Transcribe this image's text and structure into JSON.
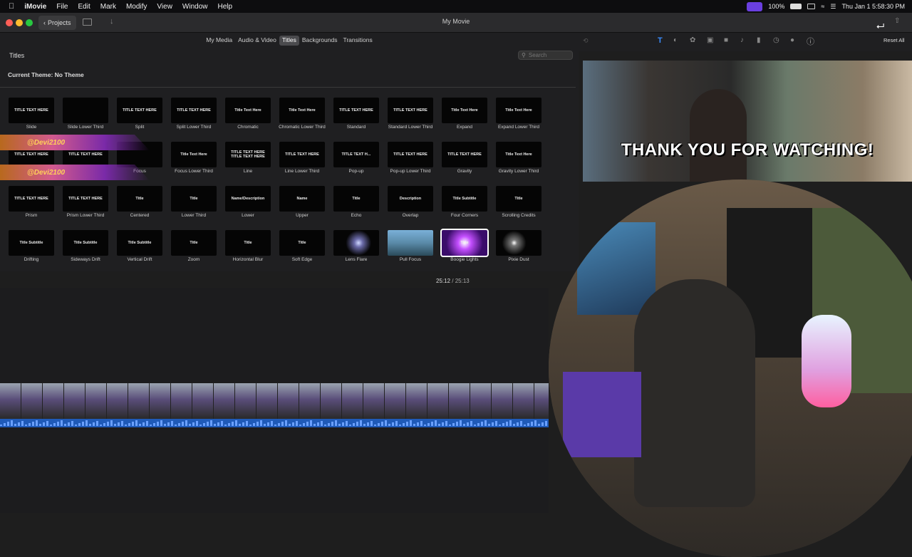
{
  "menubar": {
    "apple": "",
    "app": "iMovie",
    "items": [
      "File",
      "Edit",
      "Mark",
      "Modify",
      "View",
      "Window",
      "Help"
    ],
    "battery": "100%",
    "clock": "Thu Jan 1  5:58:30 PM"
  },
  "toolbar": {
    "projects_label": "Projects",
    "window_title": "My Movie",
    "reset_all": "Reset All"
  },
  "browser": {
    "tabs": [
      "My Media",
      "Audio & Video",
      "Titles",
      "Backgrounds",
      "Transitions"
    ],
    "active_tab": "Titles",
    "heading": "Titles",
    "search_placeholder": "Search",
    "theme": "Current Theme: No Theme",
    "titles": [
      {
        "label": "Slide",
        "thumb": "TITLE TEXT HERE"
      },
      {
        "label": "Slide Lower Third",
        "thumb": ""
      },
      {
        "label": "Split",
        "thumb": "TITLE TEXT HERE"
      },
      {
        "label": "Split Lower Third",
        "thumb": "TITLE TEXT HERE"
      },
      {
        "label": "Chromatic",
        "thumb": "Title Text Here"
      },
      {
        "label": "Chromatic Lower Third",
        "thumb": "Title Text Here"
      },
      {
        "label": "Standard",
        "thumb": "TITLE TEXT HERE"
      },
      {
        "label": "Standard Lower Third",
        "thumb": "TITLE TEXT HERE"
      },
      {
        "label": "Expand",
        "thumb": "Title Text Here"
      },
      {
        "label": "Expand Lower Third",
        "thumb": "Title Text Here"
      },
      {
        "label": "Focus",
        "thumb": "TITLE TEXT HERE"
      },
      {
        "label": "Focus",
        "thumb": "TITLE TEXT HERE"
      },
      {
        "label": "Focus",
        "thumb": ""
      },
      {
        "label": "Focus Lower Third",
        "thumb": "Title Text Here"
      },
      {
        "label": "Line",
        "thumb": "TITLE TEXT HERE TITLE TEXT HERE"
      },
      {
        "label": "Line Lower Third",
        "thumb": "TITLE TEXT HERE"
      },
      {
        "label": "Pop-up",
        "thumb": "TITLE TEXT H..."
      },
      {
        "label": "Pop-up Lower Third",
        "thumb": "TITLE TEXT HERE"
      },
      {
        "label": "Gravity",
        "thumb": "TITLE TEXT HERE"
      },
      {
        "label": "Gravity Lower Third",
        "thumb": "Title Text Here"
      },
      {
        "label": "Prism",
        "thumb": "TITLE TEXT HERE"
      },
      {
        "label": "Prism Lower Third",
        "thumb": "TITLE TEXT HERE"
      },
      {
        "label": "Centered",
        "thumb": "Title"
      },
      {
        "label": "Lower Third",
        "thumb": "Title"
      },
      {
        "label": "Lower",
        "thumb": "Name/Description"
      },
      {
        "label": "Upper",
        "thumb": "Name"
      },
      {
        "label": "Echo",
        "thumb": "Title"
      },
      {
        "label": "Overlap",
        "thumb": "Description"
      },
      {
        "label": "Four Corners",
        "thumb": "Title Subtitle"
      },
      {
        "label": "Scrolling Credits",
        "thumb": "Title"
      },
      {
        "label": "Drifting",
        "thumb": "Title Subtitle"
      },
      {
        "label": "Sideways Drift",
        "thumb": "Title Subtitle"
      },
      {
        "label": "Vertical Drift",
        "thumb": "Title Subtitle"
      },
      {
        "label": "Zoom",
        "thumb": "Title"
      },
      {
        "label": "Horizontal Blur",
        "thumb": "Title"
      },
      {
        "label": "Soft Edge",
        "thumb": "Title"
      },
      {
        "label": "Lens Flare",
        "thumb": ""
      },
      {
        "label": "Pull Focus",
        "thumb": ""
      },
      {
        "label": "Boogie Lights",
        "thumb": "Title"
      },
      {
        "label": "Pixie Dust",
        "thumb": ""
      }
    ],
    "selected_title": "Boogie Lights",
    "overlay_tag": "@Devi2100"
  },
  "timecode": {
    "current": "25:12",
    "separator": "/",
    "total": "25:13"
  },
  "viewer": {
    "overlay_text": "THANK YOU FOR WATCHING!"
  },
  "colors": {
    "accent": "#6a3fe0",
    "audio": "#1f5ab8",
    "selected_outline": "#ffffff"
  }
}
